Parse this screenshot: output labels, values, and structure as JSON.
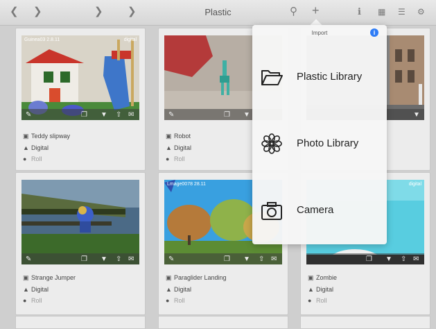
{
  "topbar": {
    "title": "Plastic",
    "back_icon": "back-chevron-icon",
    "crumbs": [
      "",
      ""
    ]
  },
  "grid": {
    "cards": [
      {
        "stamp_left": "Guinea03 2.8.11",
        "stamp_right": "digital",
        "name": "Teddy slipway",
        "camera": "Digital",
        "film": "Roll"
      },
      {
        "stamp_left": "",
        "stamp_right": "",
        "name": "Robot",
        "camera": "Digital",
        "film": "Roll"
      },
      {
        "stamp_left": "",
        "stamp_right": "",
        "name": "",
        "camera": "",
        "film": ""
      },
      {
        "stamp_left": "",
        "stamp_right": "",
        "name": "Strange Jumper",
        "camera": "Digital",
        "film": "Roll"
      },
      {
        "stamp_left": "Lmage0078 28.11",
        "stamp_right": "",
        "name": "Paraglider Landing",
        "camera": "Digital",
        "film": "Roll"
      },
      {
        "stamp_left": "",
        "stamp_right": "digital",
        "name": "Zombie",
        "camera": "Digital",
        "film": "Roll"
      }
    ]
  },
  "popover": {
    "title": "Import",
    "info_label": "i",
    "items": [
      {
        "label": "Plastic Library",
        "icon": "folder-open-icon"
      },
      {
        "label": "Photo Library",
        "icon": "photos-flower-icon"
      },
      {
        "label": "Camera",
        "icon": "camera-icon"
      }
    ]
  },
  "colors": {
    "accent": "#2e7cf6",
    "sky": "#39a0e0",
    "grass": "#5c8c34",
    "teal": "#58cde0"
  }
}
